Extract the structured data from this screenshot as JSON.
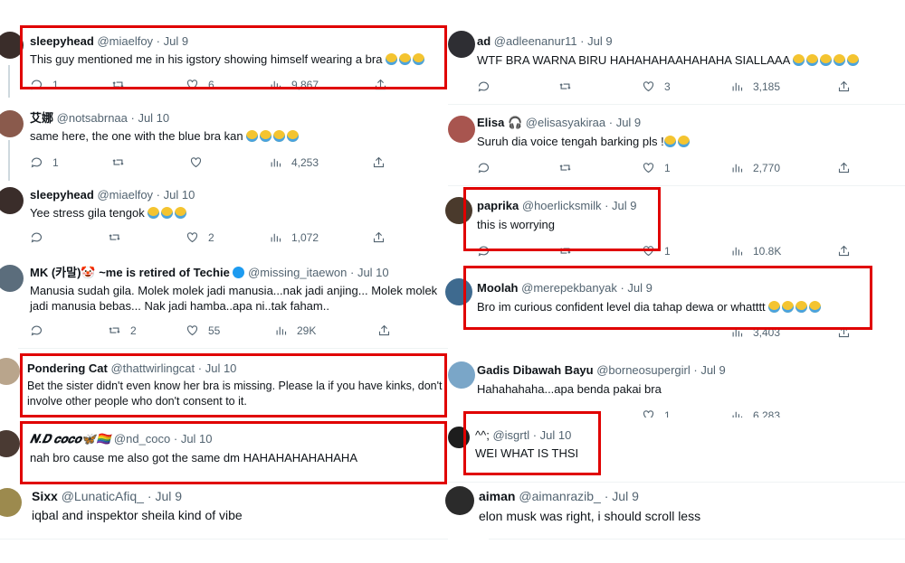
{
  "left": [
    {
      "name": "sleepyhead",
      "handle": "@miaelfoy",
      "date": "Jul 9",
      "text": "This guy mentioned me in his igstory showing himself wearing a bra",
      "emoji_count": 3,
      "reply": "1",
      "like": "6",
      "views": "9,867"
    },
    {
      "name": "艾娜",
      "handle": "@notsabrnaa",
      "date": "Jul 10",
      "text": "same here, the one with the blue bra kan",
      "emoji_count": 4,
      "reply": "1",
      "like": "",
      "views": "4,253"
    },
    {
      "name": "sleepyhead",
      "handle": "@miaelfoy",
      "date": "Jul 10",
      "text": "Yee stress gila tengok",
      "emoji_count": 3,
      "reply": "",
      "like": "2",
      "views": "1,072"
    },
    {
      "name": "MK (카말)🤡 ~me is retired of Techie",
      "handle": "@missing_itaewon",
      "date": "Jul 10",
      "text": "Manusia sudah gila. Molek molek jadi manusia...nak jadi anjing... Molek molek jadi manusia bebas... Nak jadi hamba..apa ni..tak faham..",
      "emoji_count": 0,
      "reply": "",
      "retweet": "2",
      "like": "55",
      "views": "29K"
    },
    {
      "name": "Pondering Cat",
      "handle": "@thattwirlingcat",
      "date": "Jul 10",
      "text": "Bet the sister didn't even know her bra is missing. Please la if you have kinks, don't involve other people who don't consent to it.",
      "emoji_count": 0
    },
    {
      "name": "𝑵.𝑫 𝒄𝒐𝒄𝒐🦋🏳️‍🌈",
      "handle": "@nd_coco",
      "date": "Jul 10",
      "text": "nah bro cause me also got the same dm HAHAHAHAHAHAHA",
      "emoji_count": 0
    },
    {
      "name": "Sixx",
      "handle": "@LunaticAfiq_",
      "date": "Jul 9",
      "text": "iqbal and inspektor sheila kind of vibe",
      "emoji_count": 0
    }
  ],
  "right": [
    {
      "name": "ad",
      "handle": "@adleenanur11",
      "date": "Jul 9",
      "text": "WTF BRA WARNA BIRU HAHAHAHAAHAHAHA SIALLAAA",
      "emoji_count": 5,
      "reply": "",
      "like": "3",
      "views": "3,185"
    },
    {
      "name": "Elisa 🎧",
      "handle": "@elisasyakiraa",
      "date": "Jul 9",
      "text": "Suruh dia voice tengah barking pls !",
      "emoji_count": 2,
      "reply": "",
      "like": "1",
      "views": "2,770"
    },
    {
      "name": "paprika",
      "handle": "@hoerlicksmilk",
      "date": "Jul 9",
      "text": "this is worrying",
      "emoji_count": 0,
      "like": "1",
      "views": "10.8K"
    },
    {
      "name": "Moolah",
      "handle": "@merepekbanyak",
      "date": "Jul 9",
      "text": "Bro im curious confident level dia tahap dewa or whatttt",
      "emoji_count": 4,
      "views": "3,403"
    },
    {
      "name": "Gadis Dibawah Bayu",
      "handle": "@borneosupergirl",
      "date": "Jul 9",
      "text": "Hahahahaha...apa benda pakai bra",
      "emoji_count": 0,
      "like": "1",
      "views": "6,283"
    },
    {
      "name": "^^;",
      "handle": "@isgrtl",
      "date": "Jul 10",
      "text": "WEI WHAT IS THSI",
      "emoji_count": 0
    },
    {
      "name": "aiman",
      "handle": "@aimanrazib_",
      "date": "Jul 9",
      "text": "elon musk was right, i should scroll less",
      "emoji_count": 0
    }
  ],
  "sep": " · ",
  "colors": {
    "highlight": "#e00000",
    "meta": "#536471",
    "text": "#0f1419"
  }
}
